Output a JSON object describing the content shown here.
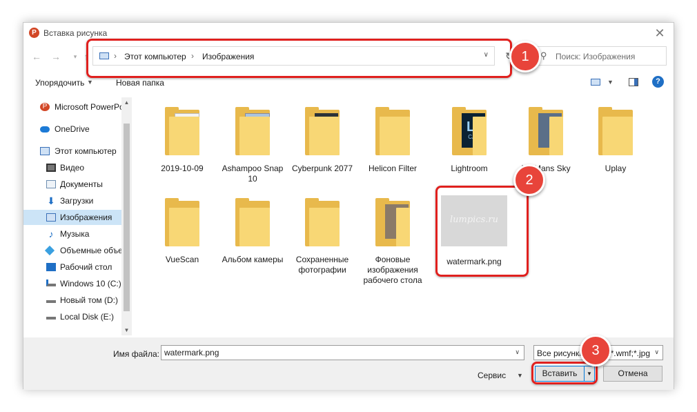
{
  "window": {
    "title": "Вставка рисунка",
    "app_icon_letter": "P"
  },
  "address": {
    "crumbs": [
      "Этот компьютер",
      "Изображения"
    ]
  },
  "search": {
    "placeholder": "Поиск: Изображения"
  },
  "toolbar": {
    "organize_label": "Упорядочить",
    "new_folder_label": "Новая папка",
    "help_label": "?"
  },
  "nav_pane": {
    "items": [
      {
        "label": "Microsoft PowerPoint",
        "icon": "powerpoint-icon"
      },
      {
        "label": "OneDrive",
        "icon": "cloud-icon"
      },
      {
        "label": "Этот компьютер",
        "icon": "computer-icon"
      },
      {
        "label": "Видео",
        "icon": "video-icon"
      },
      {
        "label": "Документы",
        "icon": "documents-icon"
      },
      {
        "label": "Загрузки",
        "icon": "downloads-icon"
      },
      {
        "label": "Изображения",
        "icon": "pictures-icon",
        "selected": true
      },
      {
        "label": "Музыка",
        "icon": "music-icon"
      },
      {
        "label": "Объемные объекты",
        "icon": "3d-objects-icon"
      },
      {
        "label": "Рабочий стол",
        "icon": "desktop-icon"
      },
      {
        "label": "Windows 10 (C:)",
        "icon": "drive-icon"
      },
      {
        "label": "Новый том (D:)",
        "icon": "drive-icon"
      },
      {
        "label": "Local Disk (E:)",
        "icon": "drive-icon"
      }
    ]
  },
  "files": [
    {
      "name": "2019-10-09",
      "type": "folder"
    },
    {
      "name": "Ashampoo Snap 10",
      "type": "folder"
    },
    {
      "name": "Cyberpunk 2077",
      "type": "folder"
    },
    {
      "name": "Helicon Filter",
      "type": "folder"
    },
    {
      "name": "Lightroom",
      "type": "folder",
      "thumb_text": "Lr",
      "thumb_subtext": "CAT"
    },
    {
      "name": "No Mans Sky",
      "type": "folder"
    },
    {
      "name": "Uplay",
      "type": "folder"
    },
    {
      "name": "VueScan",
      "type": "folder"
    },
    {
      "name": "Альбом камеры",
      "type": "folder"
    },
    {
      "name": "Сохраненные фотографии",
      "type": "folder"
    },
    {
      "name": "Фоновые изображения рабочего стола",
      "type": "folder"
    },
    {
      "name": "watermark.png",
      "type": "image",
      "thumb_text": "lumpics.ru"
    }
  ],
  "bottom": {
    "filename_label": "Имя файла:",
    "filename_value": "watermark.png",
    "filetype_value": "Все рисунки (*.emf;*.wmf;*.jpg",
    "service_label": "Сервис",
    "insert_label": "Вставить",
    "cancel_label": "Отмена"
  },
  "annotations": {
    "badge1": "1",
    "badge2": "2",
    "badge3": "3",
    "color": "#e0201e"
  }
}
